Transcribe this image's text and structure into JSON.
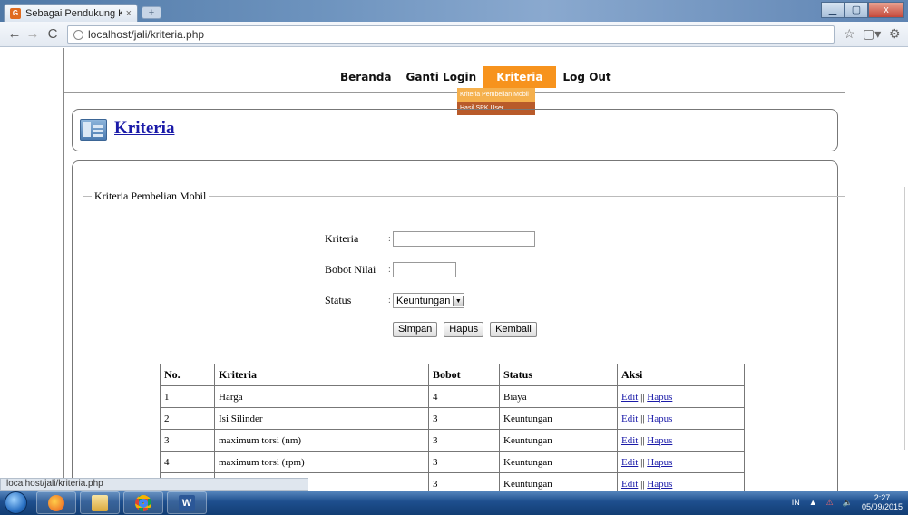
{
  "browser": {
    "tab_title": "Sebagai Pendukung Kep...",
    "tab_close": "×",
    "newtab": "+",
    "url": "localhost/jali/kriteria.php",
    "window_buttons": {
      "min": "▁",
      "max": "▢",
      "close": "x"
    },
    "status_text": "localhost/jali/kriteria.php"
  },
  "nav": {
    "items": [
      "Beranda",
      "Ganti Login",
      "Kriteria",
      "Log Out"
    ],
    "submenu": [
      "Kriteria Pembelian Mobil",
      "Hasil SPK User"
    ]
  },
  "page": {
    "title": "Kriteria"
  },
  "form": {
    "legend": "Kriteria Pembelian Mobil",
    "label_kriteria": "Kriteria",
    "label_bobot": "Bobot Nilai",
    "label_status": "Status",
    "colon": ":",
    "status_selected": "Keuntungan",
    "btn_simpan": "Simpan",
    "btn_hapus": "Hapus",
    "btn_kembali": "Kembali"
  },
  "table": {
    "headers": [
      "No.",
      "Kriteria",
      "Bobot",
      "Status",
      "Aksi"
    ],
    "rows": [
      {
        "no": "1",
        "kriteria": "Harga",
        "bobot": "4",
        "status": "Biaya"
      },
      {
        "no": "2",
        "kriteria": "Isi Silinder",
        "bobot": "3",
        "status": "Keuntungan"
      },
      {
        "no": "3",
        "kriteria": "maximum torsi (nm)",
        "bobot": "3",
        "status": "Keuntungan"
      },
      {
        "no": "4",
        "kriteria": "maximum torsi (rpm)",
        "bobot": "3",
        "status": "Keuntungan"
      },
      {
        "no": "",
        "kriteria": "",
        "bobot": "3",
        "status": "Keuntungan"
      }
    ],
    "action_edit": "Edit",
    "action_sep": " || ",
    "action_hapus": "Hapus"
  },
  "taskbar": {
    "lang": "IN",
    "time": "2:27",
    "date": "05/09/2015"
  },
  "colors": {
    "menu_active": "#f7931d",
    "submenu": "#b85a2a",
    "link": "#1a1aa8"
  }
}
